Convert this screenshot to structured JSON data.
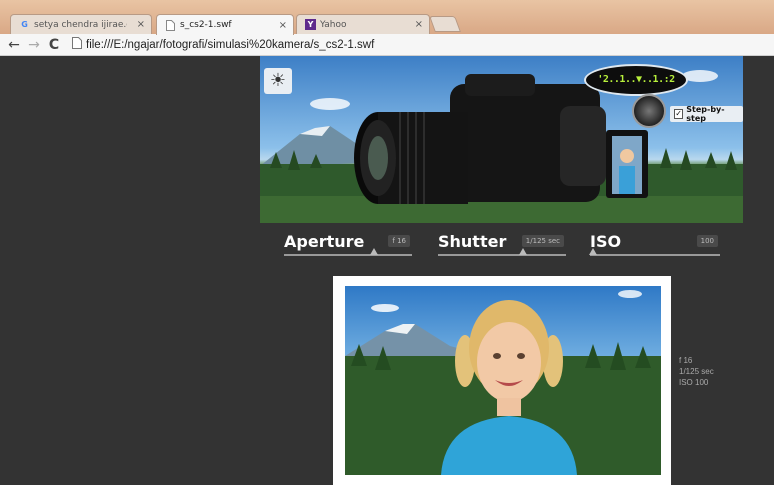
{
  "browser": {
    "tabs": [
      {
        "title": "setya chendra ijirae.com -",
        "favicon": "google-g-icon"
      },
      {
        "title": "s_cs2-1.swf",
        "favicon": "page-icon"
      },
      {
        "title": "Yahoo",
        "favicon": "yahoo-icon"
      }
    ],
    "close_glyph": "×",
    "address": "file:///E:/ngajar/fotografi/simulasi%20kamera/s_cs2-1.swf"
  },
  "camera": {
    "dial_text": "'2..1..▼..1.:2",
    "step_by_step_label": "Step-by-step",
    "step_by_step_checked": true
  },
  "controls": {
    "aperture": {
      "label": "Aperture",
      "value": "f 16",
      "slider_fraction": 0.68
    },
    "shutter": {
      "label": "Shutter",
      "value": "1/125 sec",
      "slider_fraction": 0.64
    },
    "iso": {
      "label": "ISO",
      "value": "100",
      "slider_fraction": 0.0
    }
  },
  "readout": {
    "aperture": "f 16",
    "shutter": "1/125 sec",
    "iso": "ISO 100"
  },
  "colors": {
    "background": "#333333",
    "tabbar": "#d9a886",
    "dial_text": "#b8f03c"
  }
}
